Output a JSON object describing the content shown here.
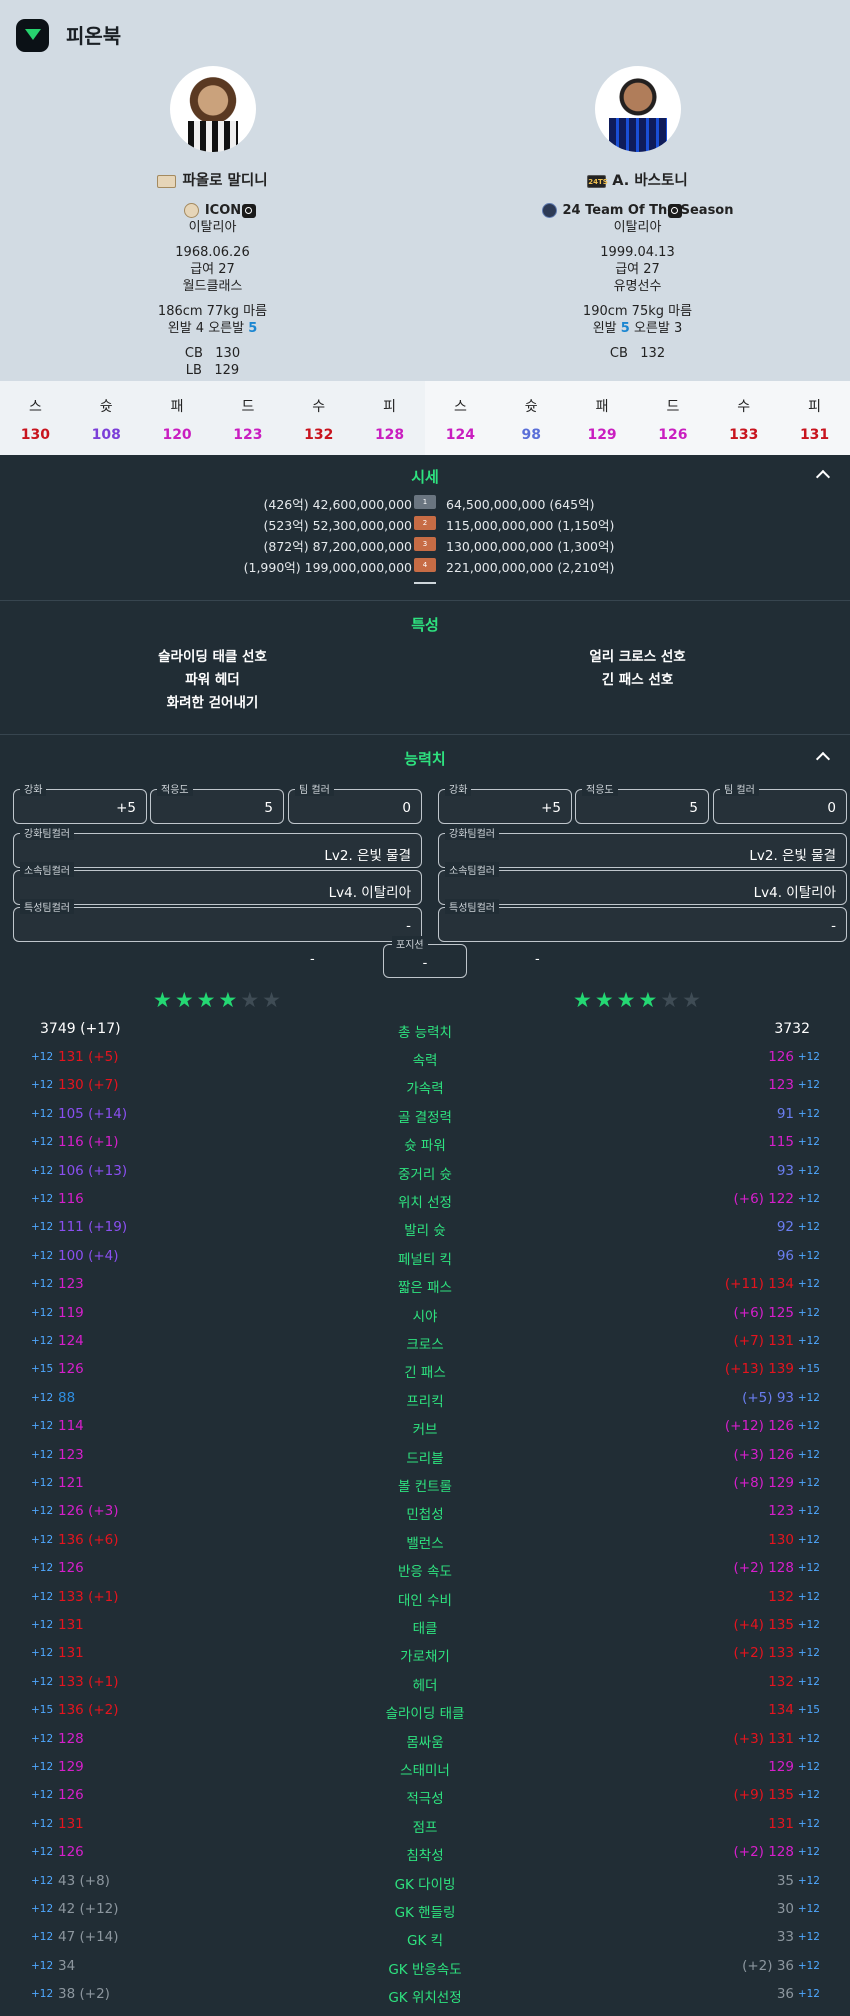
{
  "app": {
    "title": "피온북"
  },
  "players": [
    {
      "name": "파올로 말디니",
      "badge_text": "",
      "season": "ICON",
      "nation": "이탈리아",
      "birth": "1968.06.26",
      "salary": "급여 27",
      "grade": "월드클래스",
      "body": "186cm 77kg 마름",
      "foot_pre": "왼발 4 오른발",
      "foot_hl": "5",
      "positions": [
        {
          "pos": "CB",
          "ovr": "130"
        },
        {
          "pos": "LB",
          "ovr": "129"
        }
      ],
      "summary": [
        {
          "k": "스",
          "v": "130",
          "c": "#c8141e"
        },
        {
          "k": "슛",
          "v": "108",
          "c": "#7b3fd8"
        },
        {
          "k": "패",
          "v": "120",
          "c": "#c91ec0"
        },
        {
          "k": "드",
          "v": "123",
          "c": "#c91ec0"
        },
        {
          "k": "수",
          "v": "132",
          "c": "#c8141e"
        },
        {
          "k": "피",
          "v": "128",
          "c": "#c91ec0"
        }
      ]
    },
    {
      "name": "A. 바스토니",
      "badge_text": "24TS",
      "season": "24 Team Of The Season",
      "nation": "이탈리아",
      "birth": "1999.04.13",
      "salary": "급여 27",
      "grade": "유명선수",
      "body": "190cm 75kg 마름",
      "foot_pre": "왼발",
      "foot_hl": "5",
      "foot_post": "오른발 3",
      "positions": [
        {
          "pos": "CB",
          "ovr": "132"
        }
      ],
      "summary": [
        {
          "k": "스",
          "v": "124",
          "c": "#c91ec0"
        },
        {
          "k": "슛",
          "v": "98",
          "c": "#5a6fd8"
        },
        {
          "k": "패",
          "v": "129",
          "c": "#c91ec0"
        },
        {
          "k": "드",
          "v": "126",
          "c": "#c91ec0"
        },
        {
          "k": "수",
          "v": "133",
          "c": "#c8141e"
        },
        {
          "k": "피",
          "v": "131",
          "c": "#c8141e"
        }
      ]
    }
  ],
  "price": {
    "title": "시세",
    "rows": [
      {
        "left": "(426억) 42,600,000,000",
        "level": "1",
        "right": "64,500,000,000 (645억)",
        "color": "#6a7580"
      },
      {
        "left": "(523억) 52,300,000,000",
        "level": "2",
        "right": "115,000,000,000 (1,150억)",
        "color": "#c76c45"
      },
      {
        "left": "(872억) 87,200,000,000",
        "level": "3",
        "right": "130,000,000,000 (1,300억)",
        "color": "#c76c45"
      },
      {
        "left": "(1,990억) 199,000,000,000",
        "level": "4",
        "right": "221,000,000,000 (2,210억)",
        "color": "#c76c45"
      }
    ]
  },
  "traits": {
    "title": "특성",
    "left": [
      "슬라이딩 태클 선호",
      "파워 헤더",
      "화려한 걷어내기"
    ],
    "right": [
      "얼리 크로스 선호",
      "긴 패스 선호"
    ]
  },
  "ability": {
    "title": "능력치",
    "fields": {
      "enhance_label": "강화",
      "enhance": "+5",
      "adapt_label": "적응도",
      "adapt": "5",
      "team_label": "팀 컬러",
      "team": "0",
      "enh_team_label": "강화팀컬러",
      "enh_team": "Lv2. 은빛 물결",
      "club_label": "소속팀컬러",
      "club": "Lv4. 이탈리아",
      "trait_team_label": "특성팀컬러",
      "trait_team": "-",
      "pos_label": "포지션",
      "pos_val": "-",
      "side_dash": "-"
    },
    "total_label": "총 능력치",
    "left_total": "3749",
    "left_total_delta": "(+17)",
    "right_total": "3732",
    "stats": [
      {
        "n": "속력",
        "lp": "+12",
        "lv": "131",
        "ld": "(+5)",
        "lc": "#e5141e",
        "rd": "",
        "rv": "126",
        "rc": "#d61fcb",
        "rp": "+12"
      },
      {
        "n": "가속력",
        "lp": "+12",
        "lv": "130",
        "ld": "(+7)",
        "lc": "#e5141e",
        "rd": "",
        "rv": "123",
        "rc": "#d61fcb",
        "rp": "+12"
      },
      {
        "n": "골 결정력",
        "lp": "+12",
        "lv": "105",
        "ld": "(+14)",
        "lc": "#8a4ff0",
        "rd": "",
        "rv": "91",
        "rc": "#6a7ef0",
        "rp": "+12"
      },
      {
        "n": "슛 파워",
        "lp": "+12",
        "lv": "116",
        "ld": "(+1)",
        "lc": "#d61fcb",
        "rd": "",
        "rv": "115",
        "rc": "#d61fcb",
        "rp": "+12"
      },
      {
        "n": "중거리 슛",
        "lp": "+12",
        "lv": "106",
        "ld": "(+13)",
        "lc": "#8a4ff0",
        "rd": "",
        "rv": "93",
        "rc": "#6a7ef0",
        "rp": "+12"
      },
      {
        "n": "위치 선정",
        "lp": "+12",
        "lv": "116",
        "ld": "",
        "lc": "#d61fcb",
        "rd": "(+6)",
        "rv": "122",
        "rc": "#d61fcb",
        "rp": "+12"
      },
      {
        "n": "발리 슛",
        "lp": "+12",
        "lv": "111",
        "ld": "(+19)",
        "lc": "#8a4ff0",
        "rd": "",
        "rv": "92",
        "rc": "#6a7ef0",
        "rp": "+12"
      },
      {
        "n": "페널티 킥",
        "lp": "+12",
        "lv": "100",
        "ld": "(+4)",
        "lc": "#8a4ff0",
        "rd": "",
        "rv": "96",
        "rc": "#6a7ef0",
        "rp": "+12"
      },
      {
        "n": "짧은 패스",
        "lp": "+12",
        "lv": "123",
        "ld": "",
        "lc": "#d61fcb",
        "rd": "(+11)",
        "rv": "134",
        "rc": "#e5141e",
        "rp": "+12"
      },
      {
        "n": "시야",
        "lp": "+12",
        "lv": "119",
        "ld": "",
        "lc": "#d61fcb",
        "rd": "(+6)",
        "rv": "125",
        "rc": "#d61fcb",
        "rp": "+12"
      },
      {
        "n": "크로스",
        "lp": "+12",
        "lv": "124",
        "ld": "",
        "lc": "#d61fcb",
        "rd": "(+7)",
        "rv": "131",
        "rc": "#e5141e",
        "rp": "+12"
      },
      {
        "n": "긴 패스",
        "lp": "+15",
        "lv": "126",
        "ld": "",
        "lc": "#d61fcb",
        "rd": "(+13)",
        "rv": "139",
        "rc": "#e5141e",
        "rp": "+15"
      },
      {
        "n": "프리킥",
        "lp": "+12",
        "lv": "88",
        "ld": "",
        "lc": "#2f8ee0",
        "rd": "(+5)",
        "rv": "93",
        "rc": "#6a7ef0",
        "rp": "+12"
      },
      {
        "n": "커브",
        "lp": "+12",
        "lv": "114",
        "ld": "",
        "lc": "#d61fcb",
        "rd": "(+12)",
        "rv": "126",
        "rc": "#d61fcb",
        "rp": "+12"
      },
      {
        "n": "드리블",
        "lp": "+12",
        "lv": "123",
        "ld": "",
        "lc": "#d61fcb",
        "rd": "(+3)",
        "rv": "126",
        "rc": "#d61fcb",
        "rp": "+12"
      },
      {
        "n": "볼 컨트롤",
        "lp": "+12",
        "lv": "121",
        "ld": "",
        "lc": "#d61fcb",
        "rd": "(+8)",
        "rv": "129",
        "rc": "#d61fcb",
        "rp": "+12"
      },
      {
        "n": "민첩성",
        "lp": "+12",
        "lv": "126",
        "ld": "(+3)",
        "lc": "#d61fcb",
        "rd": "",
        "rv": "123",
        "rc": "#d61fcb",
        "rp": "+12"
      },
      {
        "n": "밸런스",
        "lp": "+12",
        "lv": "136",
        "ld": "(+6)",
        "lc": "#e5141e",
        "rd": "",
        "rv": "130",
        "rc": "#e5141e",
        "rp": "+12"
      },
      {
        "n": "반응 속도",
        "lp": "+12",
        "lv": "126",
        "ld": "",
        "lc": "#d61fcb",
        "rd": "(+2)",
        "rv": "128",
        "rc": "#d61fcb",
        "rp": "+12"
      },
      {
        "n": "대인 수비",
        "lp": "+12",
        "lv": "133",
        "ld": "(+1)",
        "lc": "#e5141e",
        "rd": "",
        "rv": "132",
        "rc": "#e5141e",
        "rp": "+12"
      },
      {
        "n": "태클",
        "lp": "+12",
        "lv": "131",
        "ld": "",
        "lc": "#e5141e",
        "rd": "(+4)",
        "rv": "135",
        "rc": "#e5141e",
        "rp": "+12"
      },
      {
        "n": "가로채기",
        "lp": "+12",
        "lv": "131",
        "ld": "",
        "lc": "#e5141e",
        "rd": "(+2)",
        "rv": "133",
        "rc": "#e5141e",
        "rp": "+12"
      },
      {
        "n": "헤더",
        "lp": "+12",
        "lv": "133",
        "ld": "(+1)",
        "lc": "#e5141e",
        "rd": "",
        "rv": "132",
        "rc": "#e5141e",
        "rp": "+12"
      },
      {
        "n": "슬라이딩 태클",
        "lp": "+15",
        "lv": "136",
        "ld": "(+2)",
        "lc": "#e5141e",
        "rd": "",
        "rv": "134",
        "rc": "#e5141e",
        "rp": "+15"
      },
      {
        "n": "몸싸움",
        "lp": "+12",
        "lv": "128",
        "ld": "",
        "lc": "#d61fcb",
        "rd": "(+3)",
        "rv": "131",
        "rc": "#e5141e",
        "rp": "+12"
      },
      {
        "n": "스태미너",
        "lp": "+12",
        "lv": "129",
        "ld": "",
        "lc": "#d61fcb",
        "rd": "",
        "rv": "129",
        "rc": "#d61fcb",
        "rp": "+12"
      },
      {
        "n": "적극성",
        "lp": "+12",
        "lv": "126",
        "ld": "",
        "lc": "#d61fcb",
        "rd": "(+9)",
        "rv": "135",
        "rc": "#e5141e",
        "rp": "+12"
      },
      {
        "n": "점프",
        "lp": "+12",
        "lv": "131",
        "ld": "",
        "lc": "#e5141e",
        "rd": "",
        "rv": "131",
        "rc": "#e5141e",
        "rp": "+12"
      },
      {
        "n": "침착성",
        "lp": "+12",
        "lv": "126",
        "ld": "",
        "lc": "#d61fcb",
        "rd": "(+2)",
        "rv": "128",
        "rc": "#d61fcb",
        "rp": "+12"
      },
      {
        "n": "GK 다이빙",
        "lp": "+12",
        "lv": "43",
        "ld": "(+8)",
        "lc": "#8c969e",
        "rd": "",
        "rv": "35",
        "rc": "#8c969e",
        "rp": "+12"
      },
      {
        "n": "GK 핸들링",
        "lp": "+12",
        "lv": "42",
        "ld": "(+12)",
        "lc": "#8c969e",
        "rd": "",
        "rv": "30",
        "rc": "#8c969e",
        "rp": "+12"
      },
      {
        "n": "GK 킥",
        "lp": "+12",
        "lv": "47",
        "ld": "(+14)",
        "lc": "#8c969e",
        "rd": "",
        "rv": "33",
        "rc": "#8c969e",
        "rp": "+12"
      },
      {
        "n": "GK 반응속도",
        "lp": "+12",
        "lv": "34",
        "ld": "",
        "lc": "#8c969e",
        "rd": "(+2)",
        "rv": "36",
        "rc": "#8c969e",
        "rp": "+12"
      },
      {
        "n": "GK 위치선정",
        "lp": "+12",
        "lv": "38",
        "ld": "(+2)",
        "lc": "#8c969e",
        "rd": "",
        "rv": "36",
        "rc": "#8c969e",
        "rp": "+12"
      }
    ]
  },
  "stars": {
    "filled": 4,
    "total": 6
  }
}
